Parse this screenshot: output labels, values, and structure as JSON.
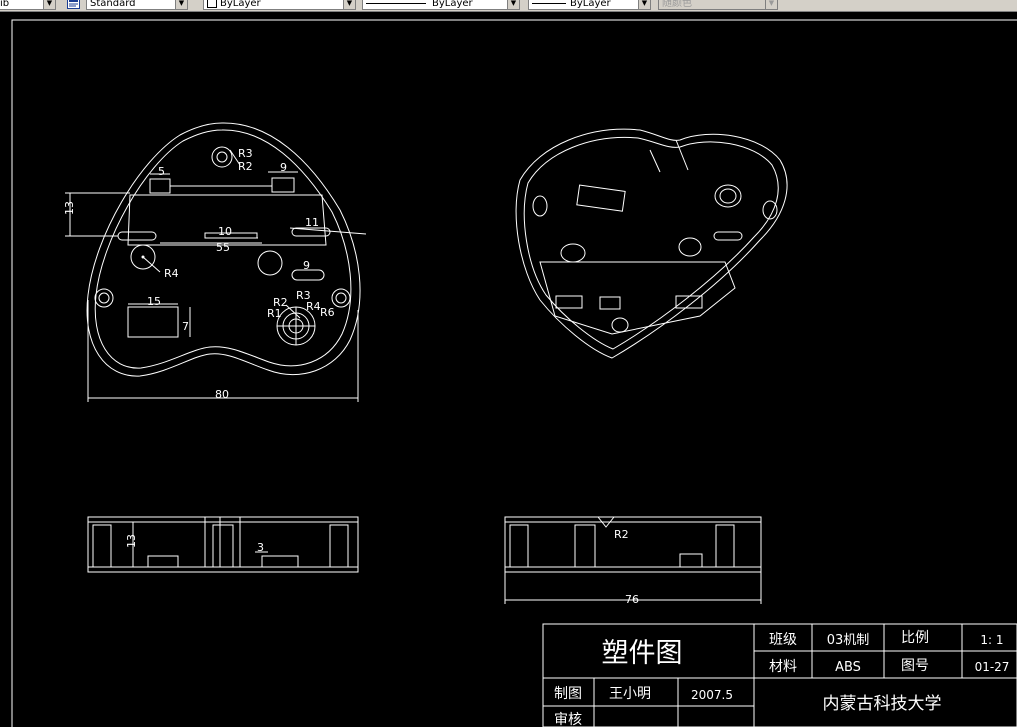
{
  "toolbar": {
    "layer_fragment": "ib",
    "text_style": "Standard",
    "color": "ByLayer",
    "linetype": "ByLayer",
    "lineweight": "ByLayer",
    "plot_style": "随颜色"
  },
  "dims": {
    "top_view": {
      "r3": "R3",
      "r2": "R2",
      "d9_top": "9",
      "d5": "5",
      "d13": "13",
      "d10": "10",
      "d55": "55",
      "d11": "11",
      "r4": "R4",
      "d9_mid": "9",
      "d15": "15",
      "d7": "7",
      "r2b": "R2",
      "r3b": "R3",
      "r4b": "R4",
      "r1": "R1",
      "r6": "R6",
      "d80": "80"
    },
    "front_view": {
      "d13": "13",
      "d3": "3"
    },
    "side_view": {
      "r2": "R2",
      "d76": "76"
    }
  },
  "title_block": {
    "title": "塑件图",
    "class_label": "班级",
    "class_value": "03机制",
    "scale_label": "比例",
    "scale_value": "1: 1",
    "material_label": "材料",
    "material_value": "ABS",
    "drawing_no_label": "图号",
    "drawing_no_value": "01-27",
    "drawn_by_label": "制图",
    "drawn_by_value": "王小明",
    "date_value": "2007.5",
    "checked_by_label": "审核",
    "school": "内蒙古科技大学"
  }
}
